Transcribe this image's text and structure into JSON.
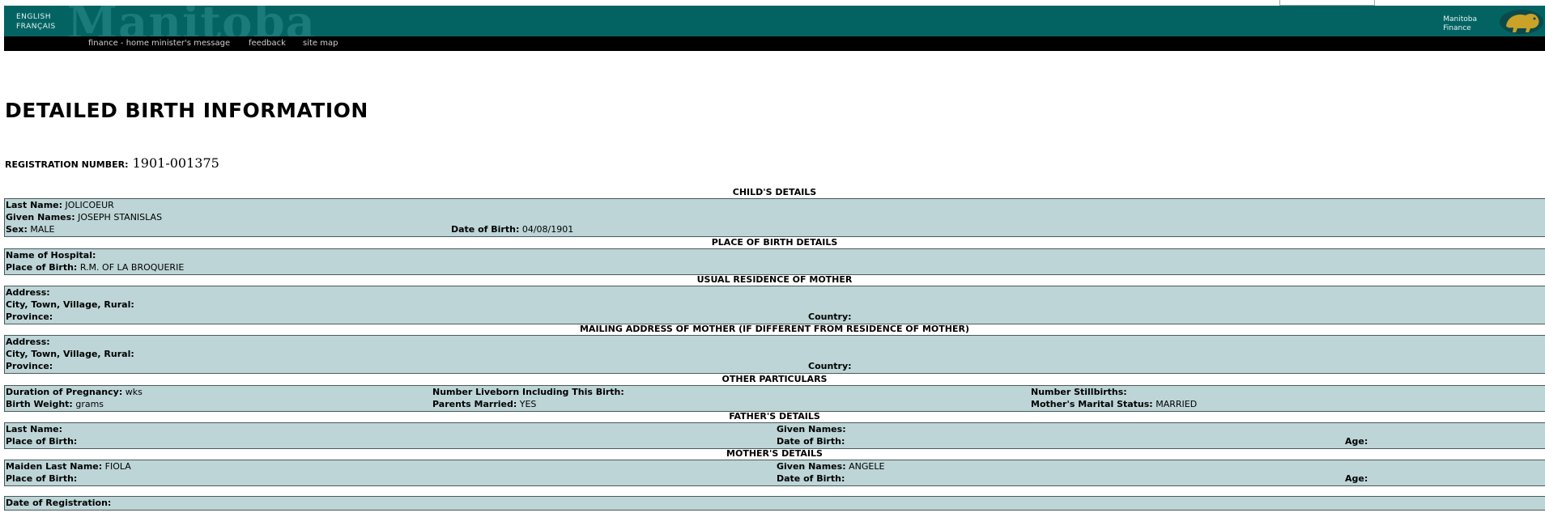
{
  "header": {
    "lang_english": "ENGLISH",
    "lang_french": "FRANÇAIS",
    "watermark": "Manitoba",
    "dept_line1": "Manitoba",
    "dept_line2": "Finance"
  },
  "nav": {
    "items": [
      "finance - home",
      "minister's message",
      "feedback",
      "site map"
    ]
  },
  "page_title": "DETAILED BIRTH INFORMATION",
  "registration": {
    "label": "REGISTRATION NUMBER:",
    "value": "1901-001375"
  },
  "child": {
    "heading": "CHILD'S DETAILS",
    "last_name_label": "Last Name:",
    "last_name": "JOLICOEUR",
    "given_label": "Given Names:",
    "given": "JOSEPH STANISLAS",
    "sex_label": "Sex:",
    "sex": "MALE",
    "dob_label": "Date of Birth:",
    "dob": "04/08/1901"
  },
  "place_of_birth": {
    "heading": "PLACE OF BIRTH DETAILS",
    "hospital_label": "Name of Hospital:",
    "hospital": "",
    "place_label": "Place of Birth:",
    "place": "R.M. OF LA BROQUERIE"
  },
  "residence": {
    "heading": "USUAL RESIDENCE OF MOTHER",
    "address_label": "Address:",
    "city_label": "City, Town, Village, Rural:",
    "province_label": "Province:",
    "country_label": "Country:"
  },
  "mailing": {
    "heading": "MAILING ADDRESS OF MOTHER (IF DIFFERENT FROM RESIDENCE OF MOTHER)",
    "address_label": "Address:",
    "city_label": "City, Town, Village, Rural:",
    "province_label": "Province:",
    "country_label": "Country:"
  },
  "other": {
    "heading": "OTHER PARTICULARS",
    "pregnancy_label": "Duration of Pregnancy:",
    "pregnancy": "wks",
    "liveborn_label": "Number Liveborn Including This Birth:",
    "stillbirths_label": "Number Stillbirths:",
    "weight_label": "Birth Weight:",
    "weight": "grams",
    "married_label": "Parents Married:",
    "married": "YES",
    "marital_label": "Mother's Marital Status:",
    "marital": "MARRIED"
  },
  "father": {
    "heading": "FATHER'S DETAILS",
    "last_name_label": "Last Name:",
    "given_label": "Given Names:",
    "pob_label": "Place of Birth:",
    "dob_label": "Date of Birth:",
    "age_label": "Age:"
  },
  "mother": {
    "heading": "MOTHER'S DETAILS",
    "maiden_label": "Maiden Last Name:",
    "maiden": "FIOLA",
    "given_label": "Given Names:",
    "given": "ANGELE",
    "pob_label": "Place of Birth:",
    "dob_label": "Date of Birth:",
    "age_label": "Age:"
  },
  "registration_date": {
    "label": "Date of Registration:"
  },
  "colors": {
    "banner": "#036363",
    "record_bg": "#bdd5d7"
  }
}
